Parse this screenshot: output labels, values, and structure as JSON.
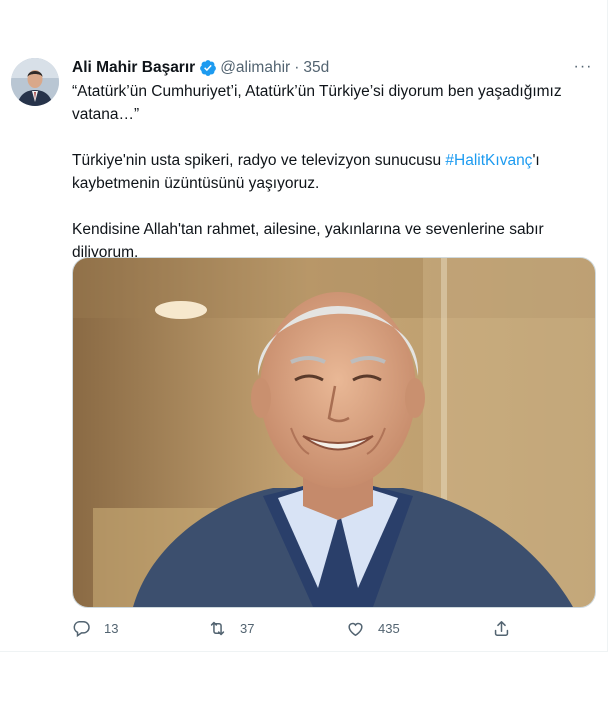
{
  "tweet": {
    "author_name": "Ali Mahir Başarır",
    "handle": "@alimahir",
    "separator": "·",
    "timestamp": "35d",
    "paragraphs": [
      {
        "text": "“Atatürk’ün Cumhuriyet’i, Atatürk’ün Türkiye’si diyorum ben yaşadığımız vatana…”"
      },
      {
        "before": "Türkiye'nin usta spikeri, radyo ve televizyon sunucusu ",
        "hashtag": "#HalitKıvanç",
        "after": "'ı kaybetmenin üzüntüsünü yaşıyoruz."
      },
      {
        "text": "Kendisine Allah'tan rahmet, ailesine, yakınlarına ve sevenlerine sabır diliyorum."
      }
    ],
    "more_label": "···",
    "stats": {
      "replies": "13",
      "retweets": "37",
      "likes": "435"
    }
  },
  "colors": {
    "accent": "#1d9bf0",
    "text": "#0f1419",
    "muted": "#536471"
  },
  "icons": [
    "verified-badge-icon",
    "reply-icon",
    "retweet-icon",
    "like-icon",
    "share-icon",
    "more-icon"
  ]
}
